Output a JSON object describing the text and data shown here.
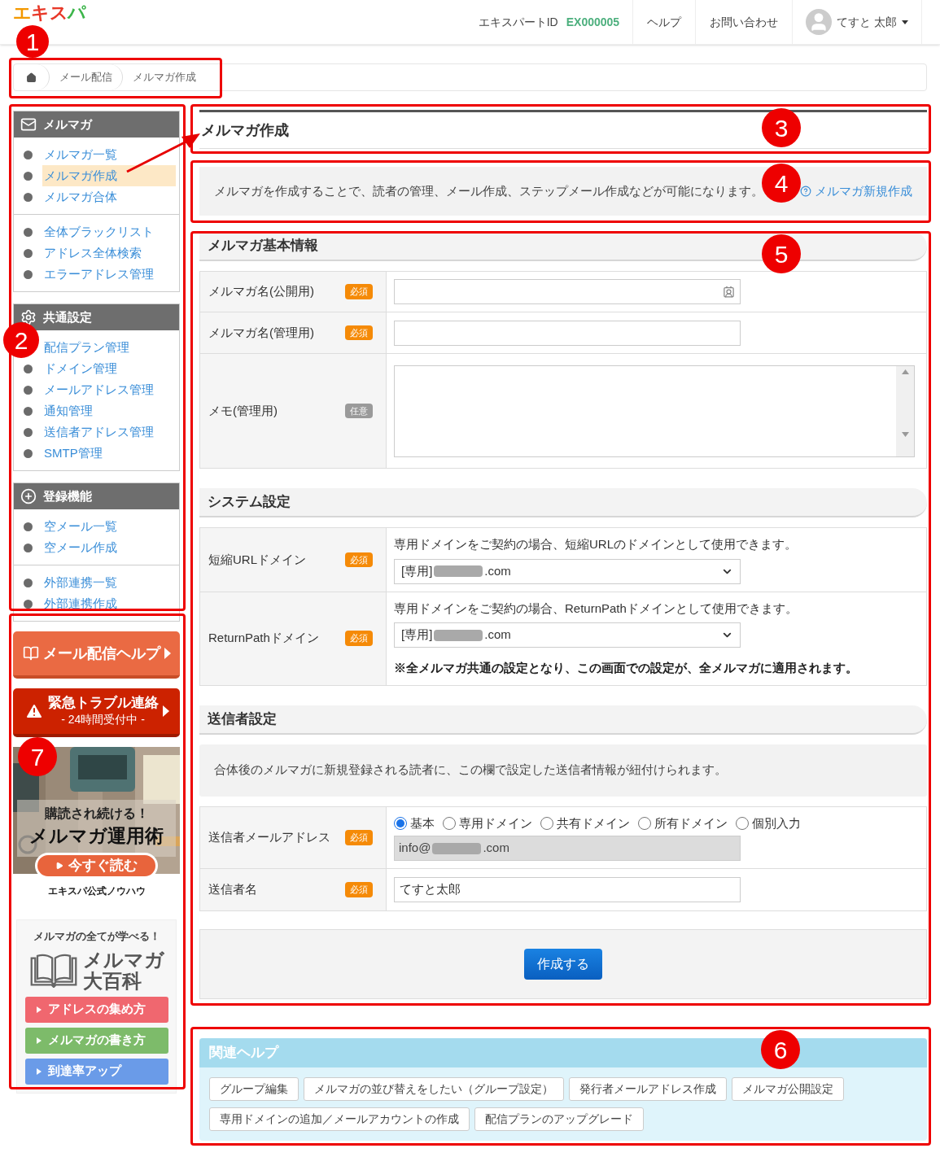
{
  "header": {
    "logo": "エキスパ",
    "id_label": "エキスパートID",
    "id_value": "EX000005",
    "links": [
      "ヘルプ",
      "お問い合わせ"
    ],
    "user": "てすと 太郎"
  },
  "breadcrumb": [
    "メール配信",
    "メルマガ作成"
  ],
  "sidebar": {
    "panels": [
      {
        "title": "メルマガ",
        "groups": [
          [
            {
              "label": "メルマガ一覧",
              "selected": false
            },
            {
              "label": "メルマガ作成",
              "selected": true
            },
            {
              "label": "メルマガ合体",
              "selected": false
            }
          ],
          [
            {
              "label": "全体ブラックリスト",
              "selected": false
            },
            {
              "label": "アドレス全体検索",
              "selected": false
            },
            {
              "label": "エラーアドレス管理",
              "selected": false
            }
          ]
        ]
      },
      {
        "title": "共通設定",
        "groups": [
          [
            {
              "label": "配信プラン管理",
              "selected": false
            },
            {
              "label": "ドメイン管理",
              "selected": false
            },
            {
              "label": "メールアドレス管理",
              "selected": false
            },
            {
              "label": "通知管理",
              "selected": false
            },
            {
              "label": "送信者アドレス管理",
              "selected": false
            },
            {
              "label": "SMTP管理",
              "selected": false
            }
          ]
        ]
      },
      {
        "title": "登録機能",
        "groups": [
          [
            {
              "label": "空メール一覧",
              "selected": false
            },
            {
              "label": "空メール作成",
              "selected": false
            }
          ],
          [
            {
              "label": "外部連携一覧",
              "selected": false
            },
            {
              "label": "外部連携作成",
              "selected": false
            }
          ]
        ]
      }
    ]
  },
  "promo": {
    "help_button": "メール配信ヘルプ",
    "emergency": {
      "title": "緊急トラブル連絡",
      "subtitle": "- 24時間受付中 -"
    },
    "banner": {
      "kind": "picture",
      "headline": "購読され続ける！",
      "title": "メルマガ運用術",
      "button": "今すぐ読む",
      "caption": "エキスパ公式ノウハウ"
    },
    "encyclopedia": {
      "tagline": "メルマガの全てが学べる！",
      "title_lines": [
        "メルマガ",
        "大百科"
      ],
      "links": [
        {
          "label": "アドレスの集め方",
          "color": "#f0676f"
        },
        {
          "label": "メルマガの書き方",
          "color": "#7dbb6a"
        },
        {
          "label": "到達率アップ",
          "color": "#6a9be8"
        }
      ]
    }
  },
  "page_title": "メルマガ作成",
  "intro": {
    "text": "メルマガを作成することで、読者の管理、メール作成、ステップメール作成などが可能になります。",
    "link": "メルマガ新規作成"
  },
  "sections": [
    {
      "title": "メルマガ基本情報",
      "rows": [
        {
          "label": "メルマガ名(公開用)",
          "badge": "必須",
          "required": true,
          "kind": "text-icon"
        },
        {
          "label": "メルマガ名(管理用)",
          "badge": "必須",
          "required": true,
          "kind": "text"
        },
        {
          "label": "メモ(管理用)",
          "badge": "任意",
          "required": false,
          "kind": "textarea"
        }
      ]
    },
    {
      "title": "システム設定",
      "rows": [
        {
          "label": "短縮URLドメイン",
          "badge": "必須",
          "required": true,
          "kind": "select",
          "description": "専用ドメインをご契約の場合、短縮URLのドメインとして使用できます。",
          "prefix": "[専用]",
          "suffix": ".com"
        },
        {
          "label": "ReturnPathドメイン",
          "badge": "必須",
          "required": true,
          "kind": "select",
          "description": "専用ドメインをご契約の場合、ReturnPathドメインとして使用できます。",
          "prefix": "[専用]",
          "suffix": ".com",
          "note": "※全メルマガ共通の設定となり、この画面での設定が、全メルマガに適用されます。"
        }
      ]
    },
    {
      "title": "送信者設定",
      "info": "合体後のメルマガに新規登録される読者に、この欄で設定した送信者情報が紐付けられます。",
      "rows": [
        {
          "label": "送信者メールアドレス",
          "badge": "必須",
          "required": true,
          "kind": "radio-text",
          "options": [
            {
              "label": "基本",
              "selected": true
            },
            {
              "label": "専用ドメイン",
              "selected": false
            },
            {
              "label": "共有ドメイン",
              "selected": false
            },
            {
              "label": "所有ドメイン",
              "selected": false
            },
            {
              "label": "個別入力",
              "selected": false
            }
          ],
          "prefix": "info@",
          "suffix": ".com",
          "disabled": true
        },
        {
          "label": "送信者名",
          "badge": "必須",
          "required": true,
          "kind": "text",
          "value": "てすと太郎"
        }
      ]
    }
  ],
  "submit": "作成する",
  "related_help": {
    "title": "関連ヘルプ",
    "links": [
      "グループ編集",
      "メルマガの並び替えをしたい（グループ設定）",
      "発行者メールアドレス作成",
      "メルマガ公開設定",
      "専用ドメインの追加／メールアカウントの作成",
      "配信プランのアップグレード"
    ]
  },
  "annotations": [
    "1",
    "2",
    "3",
    "4",
    "5",
    "6",
    "7"
  ]
}
